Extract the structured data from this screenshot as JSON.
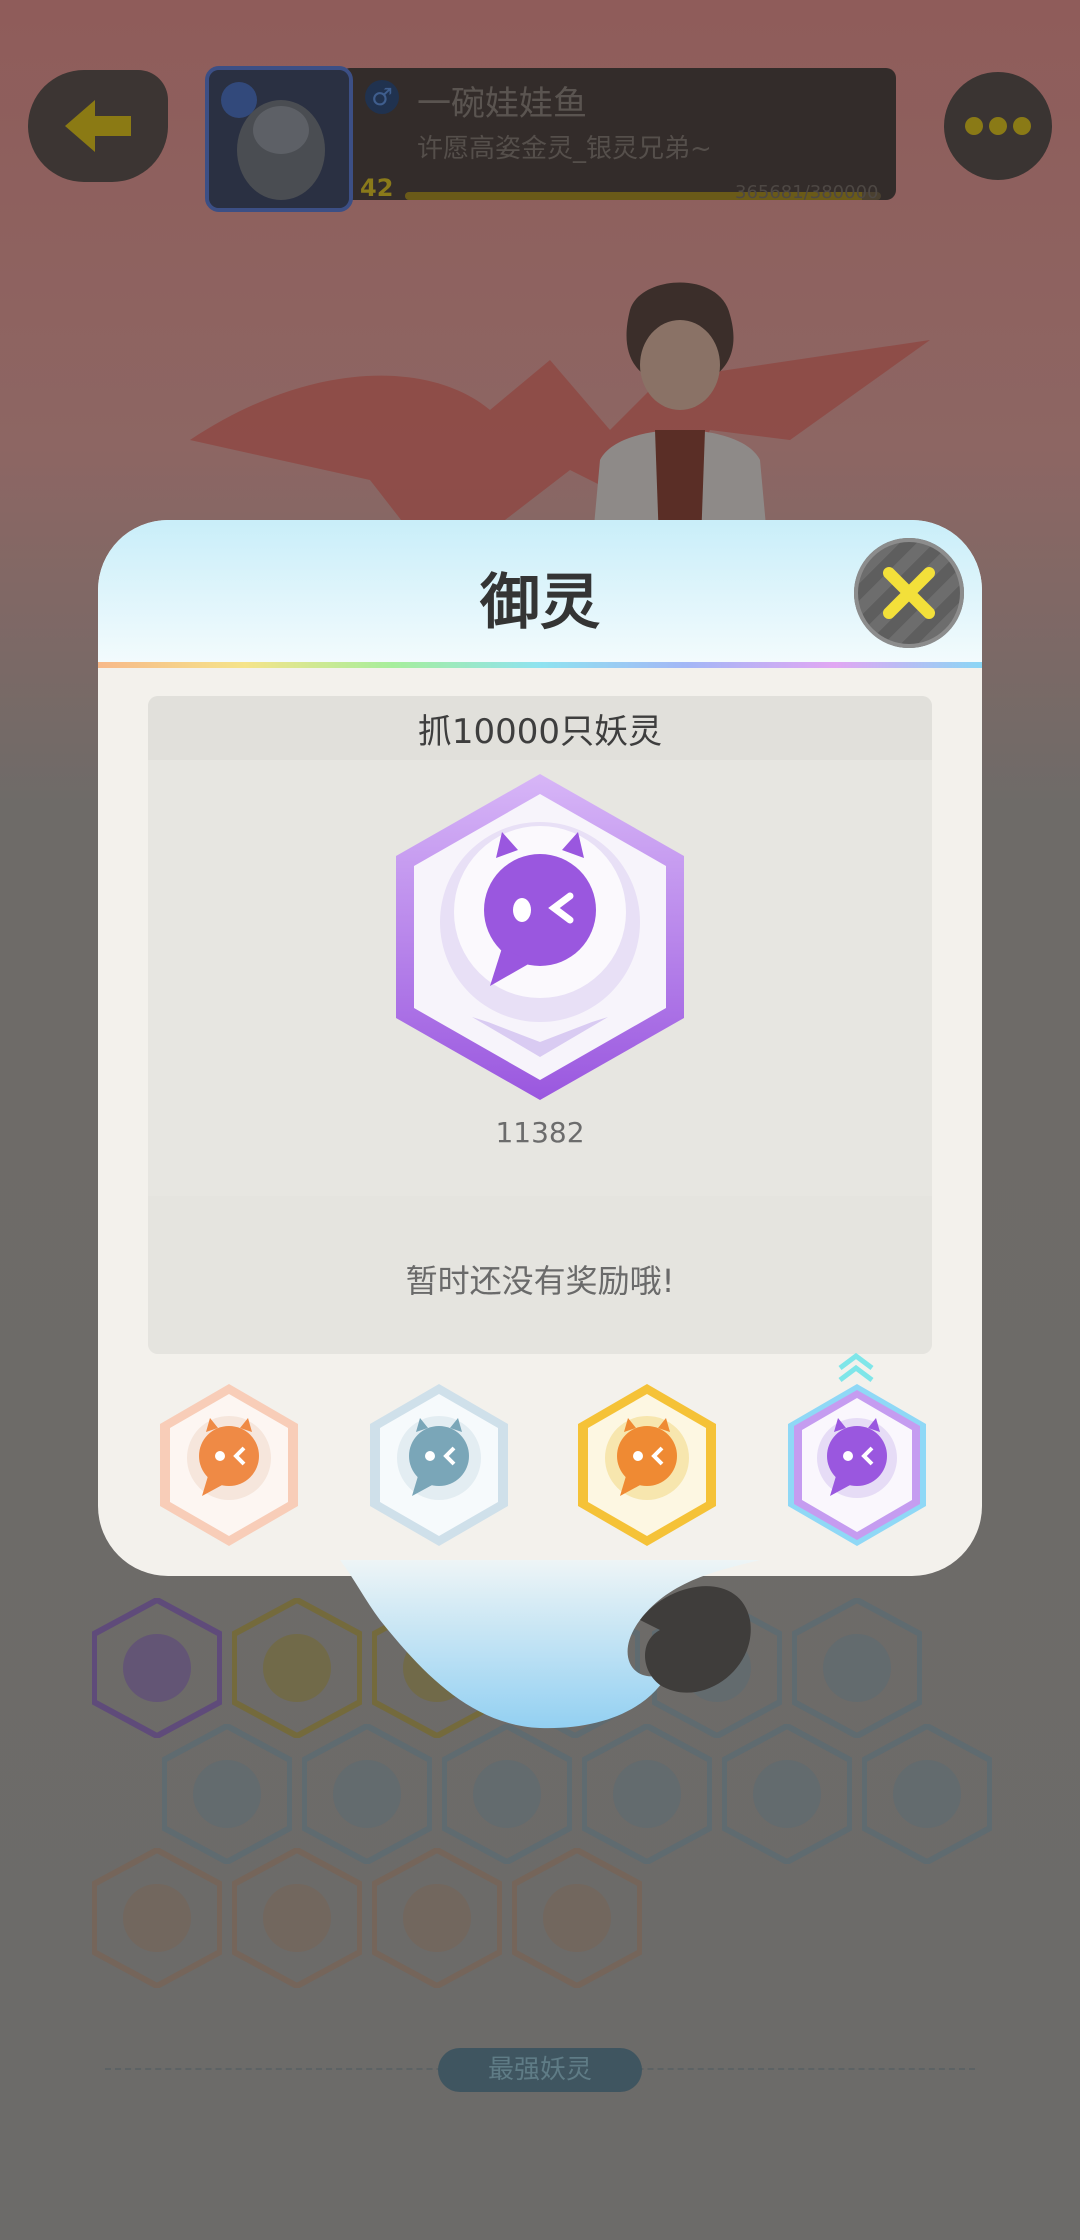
{
  "profile": {
    "nickname": "一碗娃娃鱼",
    "signature": "许愿高姿金灵_银灵兄弟~",
    "level": "42",
    "gender_symbol": "♂",
    "exp_text": "365681/380000",
    "exp_progress": 0.96
  },
  "background": {
    "strongest_label": "最强妖灵"
  },
  "modal": {
    "title": "御灵",
    "task": "抓10000只妖灵",
    "count": "11382",
    "reward_message": "暂时还没有奖励哦!"
  },
  "icons": {
    "back": "back-arrow-icon",
    "more": "more-dots-icon",
    "close": "close-x-icon"
  },
  "colors": {
    "accent_yellow": "#f3e03a",
    "purple_badge": "#9a57df",
    "orange_badge": "#ef8a45",
    "silver_badge": "#7aa6b8",
    "gold_badge": "#f5c237"
  }
}
